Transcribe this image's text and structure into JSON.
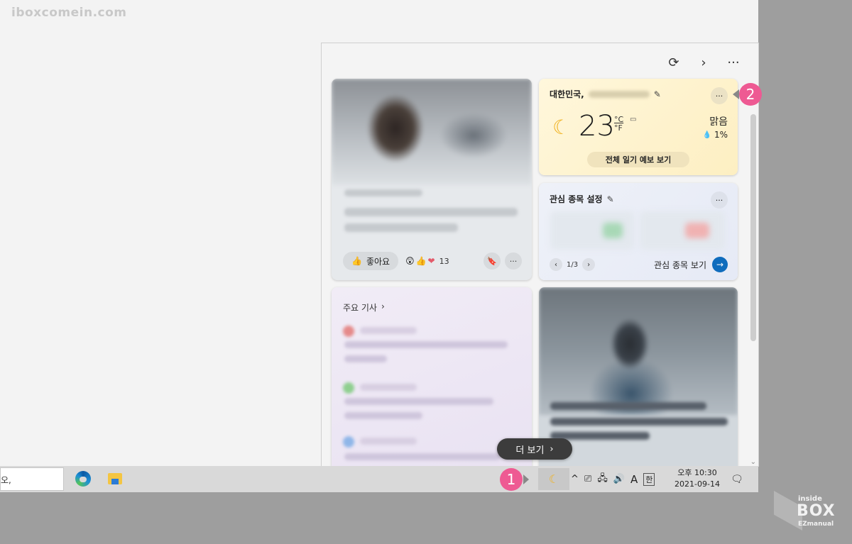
{
  "watermark": "iboxcomein.com",
  "toolbar": {
    "refresh_icon": "⟳",
    "next_icon": "›",
    "more_icon": "···"
  },
  "news_card_1": {
    "like_label": "좋아요",
    "reaction_count": "13"
  },
  "weather": {
    "location": "대한민국,",
    "temperature": "23",
    "unit_c": "°C",
    "unit_f": "°F",
    "condition": "맑음",
    "precipitation": "1%",
    "forecast_button": "전체 일기 예보 보기"
  },
  "watchlist": {
    "title": "관심 종목 설정",
    "page": "1/3",
    "view_label": "관심 종목 보기"
  },
  "top_stories": {
    "title": "주요 기사"
  },
  "more_button": "더 보기",
  "taskbar": {
    "search_text": "오,",
    "clock_time": "오후 10:30",
    "clock_date": "2021-09-14",
    "ime_mode": "A",
    "ime_han": "한"
  },
  "markers": {
    "m1": "1",
    "m2": "2"
  },
  "logo": {
    "line1": "inside",
    "line2": "BOX",
    "line3": "EZmanual"
  },
  "colors": {
    "accent": "#ee5a93",
    "watchlist_button": "#0f6cbd",
    "weather_bg": "#fdefc2"
  }
}
